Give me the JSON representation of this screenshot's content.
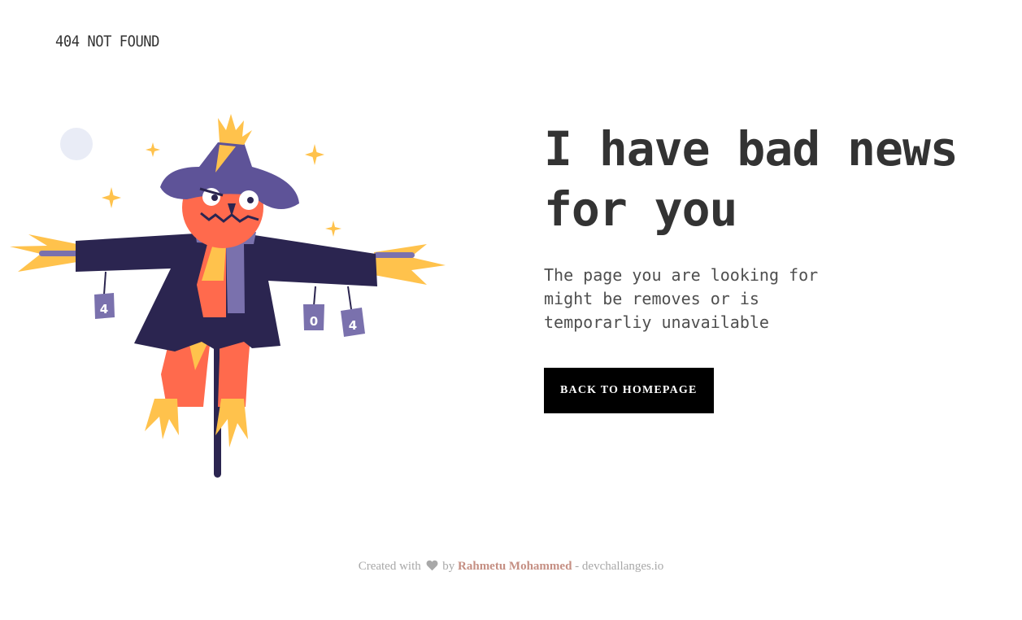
{
  "header": {
    "brand": "404 NOT FOUND"
  },
  "illustration": {
    "name": "scarecrow",
    "can_labels": [
      "4",
      "0",
      "4"
    ],
    "colors": {
      "coat": "#2b2550",
      "hat": "#5e5398",
      "head": "#ff6a4d",
      "straw": "#ffc24c",
      "cans": "#7a71ad",
      "moon": "#e9ecf6"
    }
  },
  "main": {
    "headline_line1": "I have bad news",
    "headline_line2": "for you",
    "description_line1": "The page you are looking for",
    "description_line2": "might be removes or is",
    "description_line3": "temporarliy unavailable",
    "cta_label": "BACK TO HOMEPAGE"
  },
  "footer": {
    "prefix": "Created with",
    "heart_icon": "heart-icon",
    "by": "by",
    "author": "Rahmetu Mohammed",
    "suffix": "- devchallanges.io",
    "author_color": "#c58f83"
  }
}
